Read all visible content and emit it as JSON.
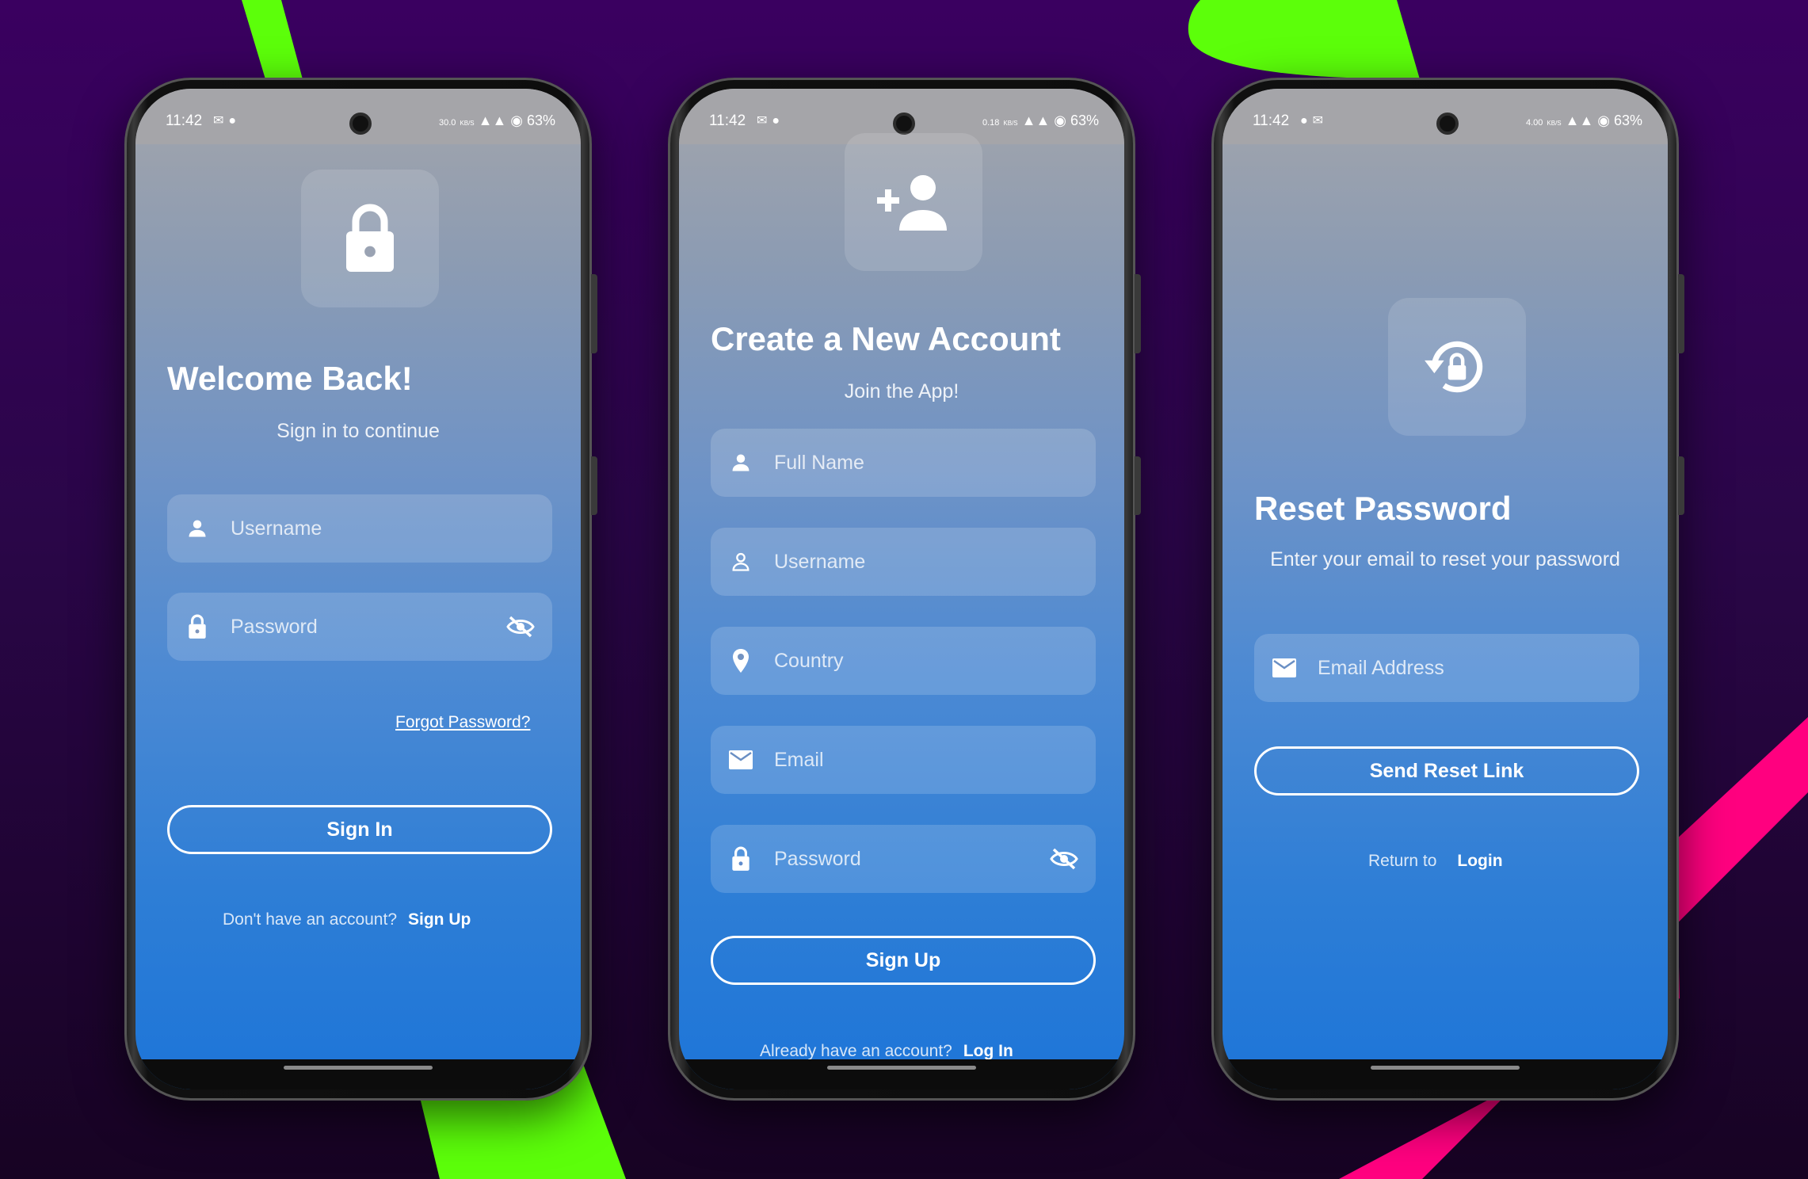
{
  "status": {
    "time": "11:42",
    "battery": "63%",
    "speeds": [
      "30.0",
      "0.18",
      "4.00"
    ],
    "speed_unit": "KB/S"
  },
  "colors": {
    "accent_green": "#5cff0a",
    "accent_pink": "#ff007f",
    "background": "#2a0a4a",
    "button_border": "#ffffff"
  },
  "login": {
    "icon": "lock-icon",
    "title": "Welcome Back!",
    "subtitle": "Sign in to continue",
    "username_placeholder": "Username",
    "password_placeholder": "Password",
    "forgot_label": "Forgot Password?",
    "submit_label": "Sign In",
    "footer_text": "Don't have an account?",
    "footer_link": "Sign Up"
  },
  "signup": {
    "icon": "person-add-icon",
    "title": "Create a New Account",
    "subtitle": "Join the App!",
    "fullname_placeholder": "Full Name",
    "username_placeholder": "Username",
    "country_placeholder": "Country",
    "email_placeholder": "Email",
    "password_placeholder": "Password",
    "submit_label": "Sign Up",
    "footer_text": "Already have an account?",
    "footer_link": "Log In"
  },
  "reset": {
    "icon": "lock-reset-icon",
    "title": "Reset Password",
    "subtitle": "Enter your email to reset your password",
    "email_placeholder": "Email Address",
    "submit_label": "Send Reset Link",
    "footer_text": "Return to",
    "footer_link": "Login"
  }
}
